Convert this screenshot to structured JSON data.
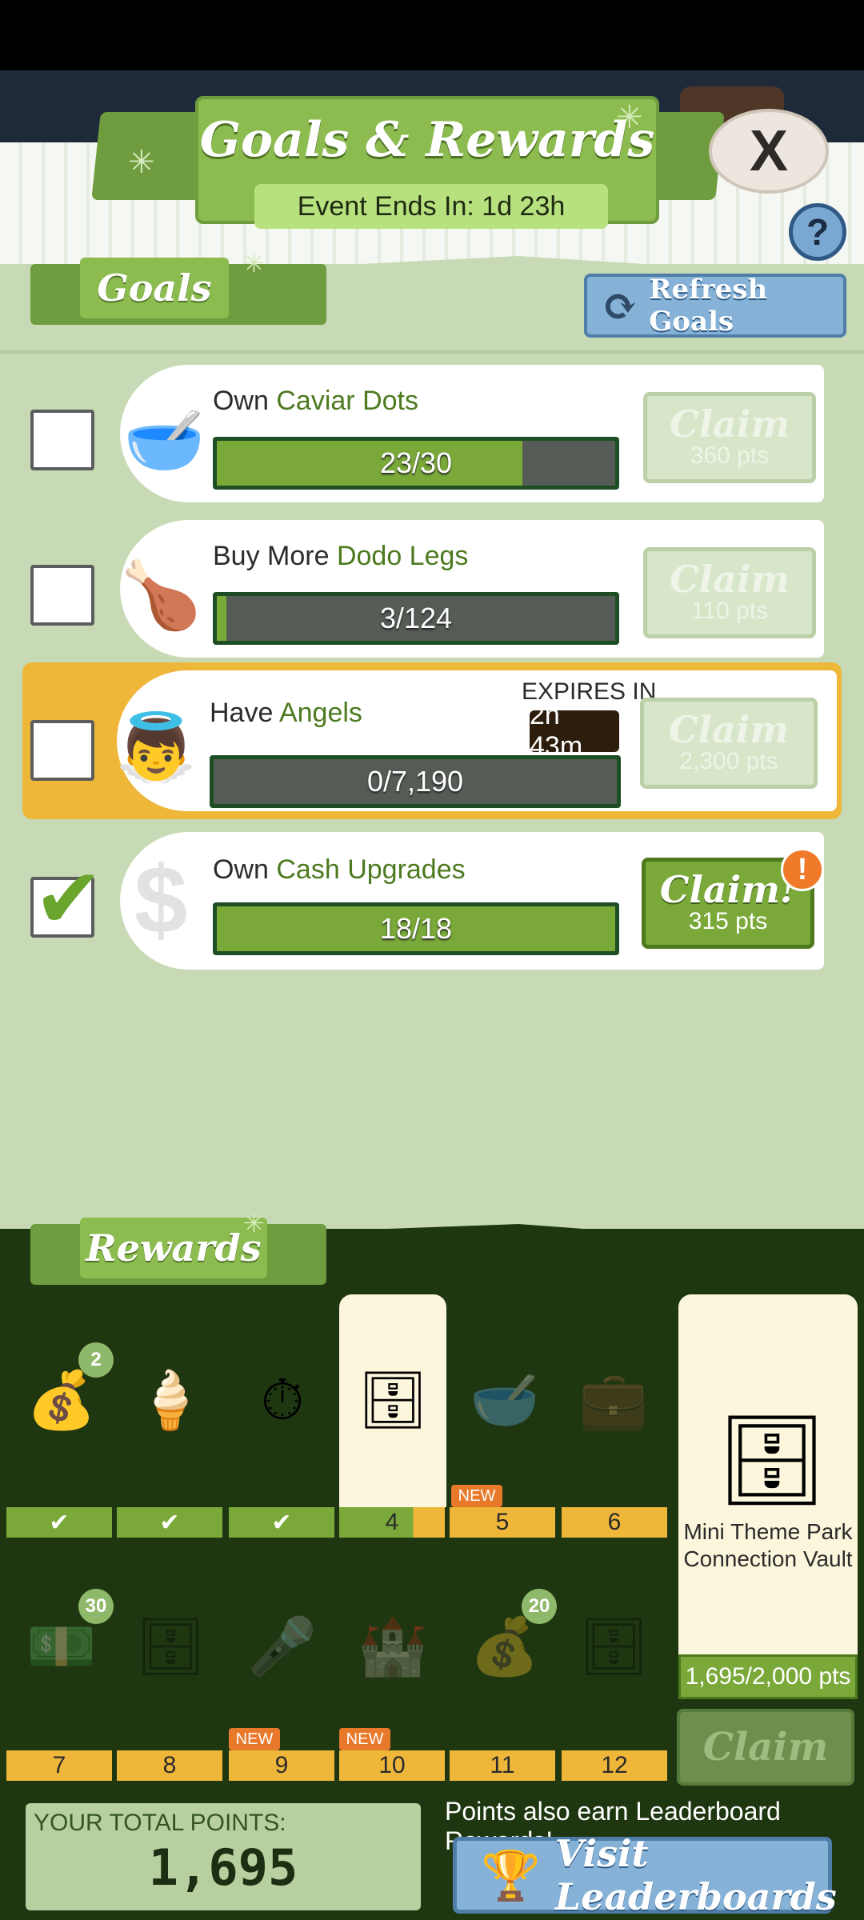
{
  "header": {
    "title": "Goals & Rewards",
    "event_ends": "Event Ends In: 1d 23h",
    "close_label": "X",
    "help_label": "?"
  },
  "goals_section": {
    "tab_label": "Goals",
    "refresh_label": "Refresh Goals",
    "items": [
      {
        "prefix": "Own",
        "highlight": "Caviar Dots",
        "progress_text": "23/30",
        "progress_fraction": 0.767,
        "claim_label": "Claim",
        "points": "360 pts",
        "checked": false,
        "icon": "caviar-bowl-icon"
      },
      {
        "prefix": "Buy More",
        "highlight": "Dodo Legs",
        "progress_text": "3/124",
        "progress_fraction": 0.024,
        "claim_label": "Claim",
        "points": "110 pts",
        "checked": false,
        "icon": "drumstick-icon"
      },
      {
        "prefix": "Have",
        "highlight": "Angels",
        "progress_text": "0/7,190",
        "progress_fraction": 0,
        "claim_label": "Claim",
        "points": "2,300 pts",
        "checked": false,
        "expires_label": "EXPIRES IN",
        "expires_time": "2h 43m",
        "icon": "angel-investor-icon"
      },
      {
        "prefix": "Own",
        "highlight": "Cash Upgrades",
        "progress_text": "18/18",
        "progress_fraction": 1,
        "claim_label": "Claim!",
        "points": "315 pts",
        "checked": true,
        "alert": "!",
        "icon": "dollar-sign-icon"
      }
    ]
  },
  "rewards_section": {
    "tab_label": "Rewards",
    "row1": [
      {
        "slot": "",
        "badge": "2",
        "state": "done",
        "icon": "gold-coins-icon"
      },
      {
        "slot": "",
        "badge": "",
        "state": "done",
        "icon": "ice-pop-icon"
      },
      {
        "slot": "",
        "badge": "",
        "state": "done",
        "icon": "time-warp-bag-icon"
      },
      {
        "slot": "4",
        "badge": "",
        "state": "current",
        "icon": "vault-icon"
      },
      {
        "slot": "5",
        "badge": "",
        "state": "new",
        "new_label": "NEW",
        "icon": "caviar-bowl-icon"
      },
      {
        "slot": "6",
        "badge": "",
        "state": "pending",
        "icon": "money-bag-1d-icon"
      }
    ],
    "row2": [
      {
        "slot": "7",
        "badge": "30",
        "state": "pending",
        "icon": "megabucks-bill-icon"
      },
      {
        "slot": "8",
        "badge": "",
        "state": "pending",
        "icon": "vault-icon"
      },
      {
        "slot": "9",
        "badge": "",
        "state": "new",
        "new_label": "NEW",
        "icon": "microphone-icon"
      },
      {
        "slot": "10",
        "badge": "",
        "state": "new",
        "new_label": "NEW",
        "icon": "theme-park-icon"
      },
      {
        "slot": "11",
        "badge": "20",
        "state": "pending",
        "icon": "gold-coins-icon"
      },
      {
        "slot": "12",
        "badge": "",
        "state": "pending",
        "icon": "vault-icon"
      }
    ],
    "big_reward": {
      "name": "Mini Theme Park Connection Vault",
      "progress": "1,695/2,000 pts",
      "claim_label": "Claim",
      "icon": "vault-icon"
    }
  },
  "footer": {
    "total_label": "YOUR TOTAL POINTS:",
    "total_value": "1,695",
    "leaderboard_note": "Points also earn Leaderboard Rewards!",
    "leaderboard_button": "Visit Leaderboards"
  },
  "colors": {
    "accent_green": "#7aa93a",
    "dark_green": "#1f3711",
    "highlight_orange": "#efb73a",
    "button_blue": "#86b2d8"
  }
}
